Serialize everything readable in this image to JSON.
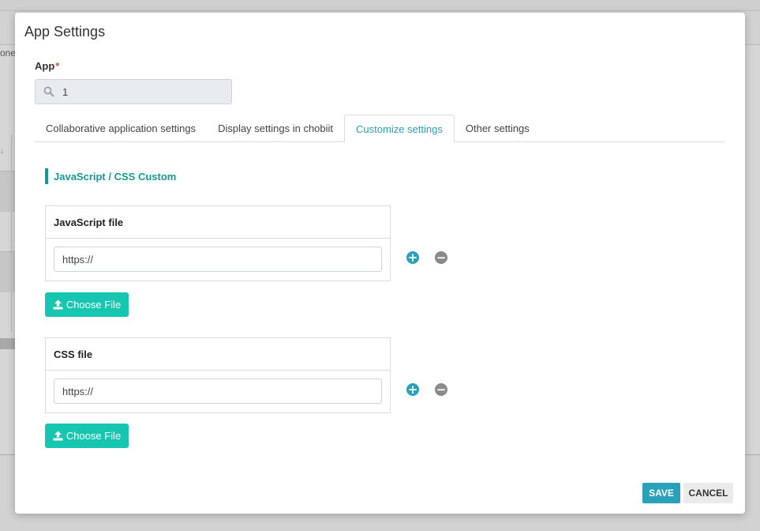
{
  "background": {
    "partial_text": "one"
  },
  "dialog": {
    "title": "App Settings",
    "app_field": {
      "label": "App",
      "required_mark": "*",
      "value": "1"
    },
    "tabs": [
      {
        "label": "Collaborative application settings",
        "active": false
      },
      {
        "label": "Display settings in chobiit",
        "active": false
      },
      {
        "label": "Customize settings",
        "active": true
      },
      {
        "label": "Other settings",
        "active": false
      }
    ],
    "section_title": "JavaScript / CSS Custom",
    "js_file": {
      "header": "JavaScript file",
      "value": "https://",
      "choose_label": "Choose File"
    },
    "css_file": {
      "header": "CSS file",
      "value": "https://",
      "choose_label": "Choose File"
    },
    "save_label": "SAVE",
    "cancel_label": "CANCEL"
  },
  "colors": {
    "accent": "#2aa1b8",
    "teal": "#139a94",
    "choose_button": "#17c6b1",
    "required": "#e2542f"
  },
  "icons": {
    "search": "search-icon",
    "upload": "upload-icon",
    "plus": "plus-circle-icon",
    "minus": "minus-circle-icon"
  }
}
